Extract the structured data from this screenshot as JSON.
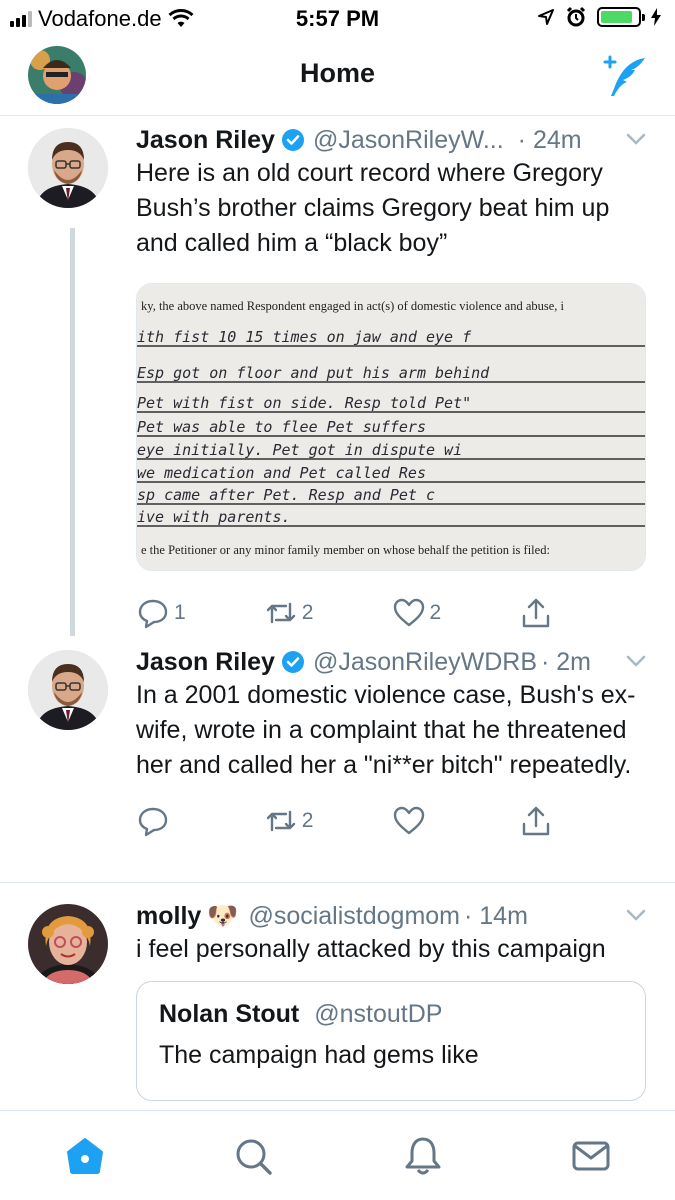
{
  "status_bar": {
    "carrier": "Vodafone.de",
    "time": "5:57 PM",
    "battery_level": 0.85,
    "battery_color": "#4cd964"
  },
  "header": {
    "title": "Home",
    "compose_icon": "compose-tweet-icon",
    "accent": "#1da1f2"
  },
  "tweets": [
    {
      "name": "Jason Riley",
      "verified": true,
      "handle": "@JasonRileyW...",
      "time": "· 24m",
      "text": "Here is an old court record where Gregory Bush’s brother claims Gregory beat him up and called him a “black boy”",
      "media": {
        "printed_top": "ky, the above named Respondent engaged in act(s) of domestic violence and abuse, i",
        "handwritten": [
          "ith fist 10 15 times on jaw and eye f",
          "Esp got on floor and put his arm behind",
          "Pet with fist on side. Resp told Pet\"",
          "Pet was able to flee Pet suffers",
          "eye initially. Pet got in dispute wi",
          "we medication and Pet called Res",
          "sp came after Pet. Resp and Pet c",
          "ive with parents."
        ],
        "printed_bottom": "e the Petitioner or any minor family member on whose behalf the petition is filed:"
      },
      "replies": "1",
      "retweets": "2",
      "likes": "2"
    },
    {
      "name": "Jason Riley",
      "verified": true,
      "handle": "@JasonRileyWDRB",
      "time": "· 2m",
      "text": "In a 2001 domestic violence case, Bush's ex-wife, wrote in a complaint that he threatened her and called her a \"ni**er bitch\" repeatedly.",
      "replies": "",
      "retweets": "2",
      "likes": ""
    },
    {
      "name": "molly",
      "emoji": "🐶",
      "handle": "@socialistdogmom",
      "time": "· 14m",
      "text": "i feel personally attacked by this campaign",
      "quote": {
        "name": "Nolan Stout",
        "handle": "@nstoutDP",
        "text": "The campaign had gems like"
      }
    }
  ],
  "tabbar": {
    "items": [
      "home-icon",
      "search-icon",
      "notifications-icon",
      "messages-icon"
    ]
  }
}
